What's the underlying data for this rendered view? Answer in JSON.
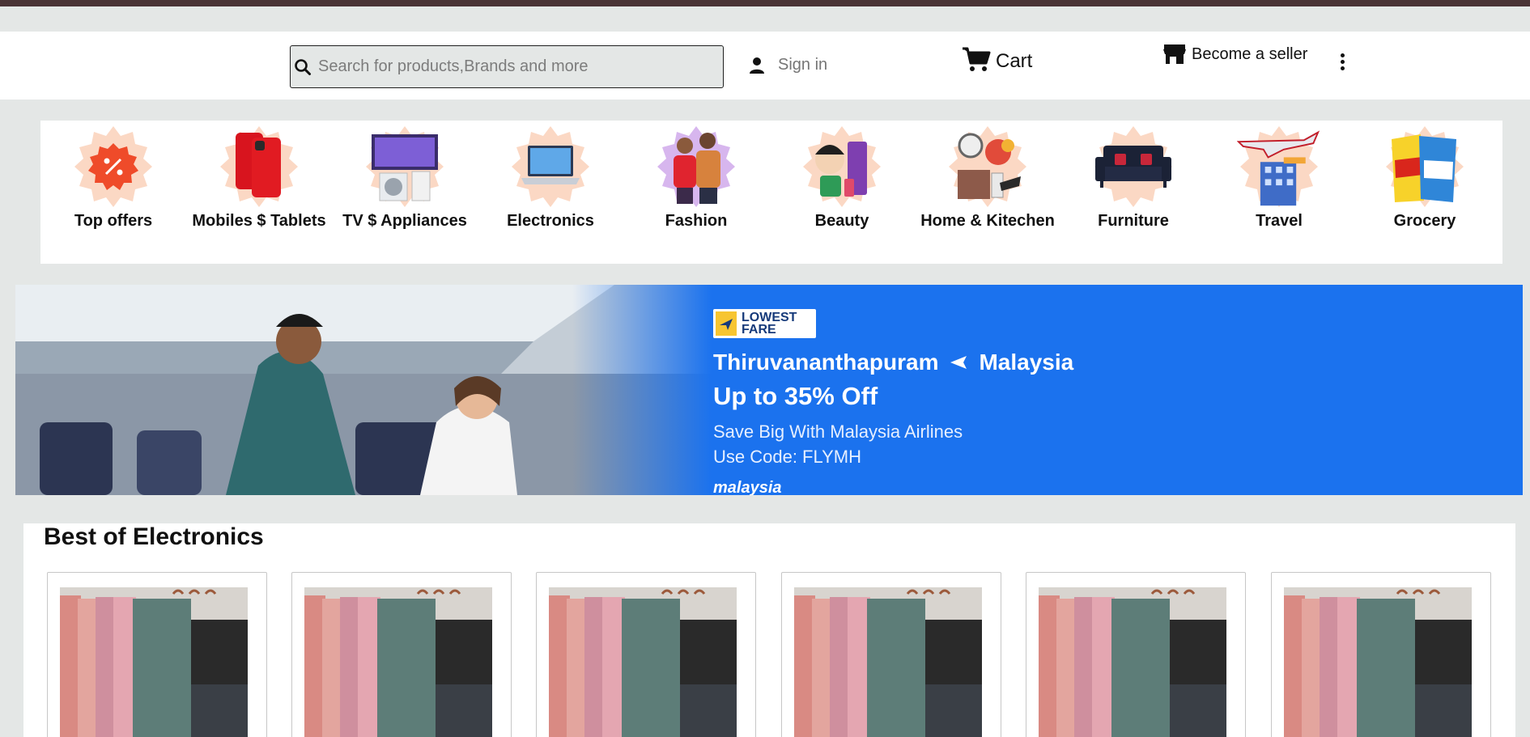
{
  "header": {
    "search_placeholder": "Search for products,Brands and more",
    "signin_label": "Sign in",
    "cart_label": "Cart",
    "seller_label": "Become a seller"
  },
  "categories": [
    {
      "label": "Top offers",
      "icon": "discount-icon"
    },
    {
      "label": "Mobiles $ Tablets",
      "icon": "phone-icon"
    },
    {
      "label": "TV $ Appliances",
      "icon": "tv-icon"
    },
    {
      "label": "Electronics",
      "icon": "laptop-icon"
    },
    {
      "label": "Fashion",
      "icon": "fashion-icon"
    },
    {
      "label": "Beauty",
      "icon": "beauty-icon"
    },
    {
      "label": "Home & Kitechen",
      "icon": "home-icon"
    },
    {
      "label": "Furniture",
      "icon": "sofa-icon"
    },
    {
      "label": "Travel",
      "icon": "travel-icon"
    },
    {
      "label": "Grocery",
      "icon": "grocery-icon"
    }
  ],
  "banner": {
    "badge_text": "LOWEST FARE",
    "from": "Thiruvananthapuram",
    "to": "Malaysia",
    "offer": "Up to 35% Off",
    "line1": "Save Big With Malaysia Airlines",
    "line2": "Use Code: FLYMH",
    "brand": "malaysia"
  },
  "section": {
    "title": "Best of Electronics",
    "products": [
      {
        "image": "towel-rack-product"
      },
      {
        "image": "towel-rack-product"
      },
      {
        "image": "towel-rack-product"
      },
      {
        "image": "towel-rack-product"
      },
      {
        "image": "towel-rack-product"
      },
      {
        "image": "towel-rack-product"
      }
    ]
  },
  "colors": {
    "accent_bar": "#4a3436",
    "page_bg": "#e4e7e6",
    "banner_blue": "#1b72ee",
    "badge_peach": "#fbd8c4"
  }
}
